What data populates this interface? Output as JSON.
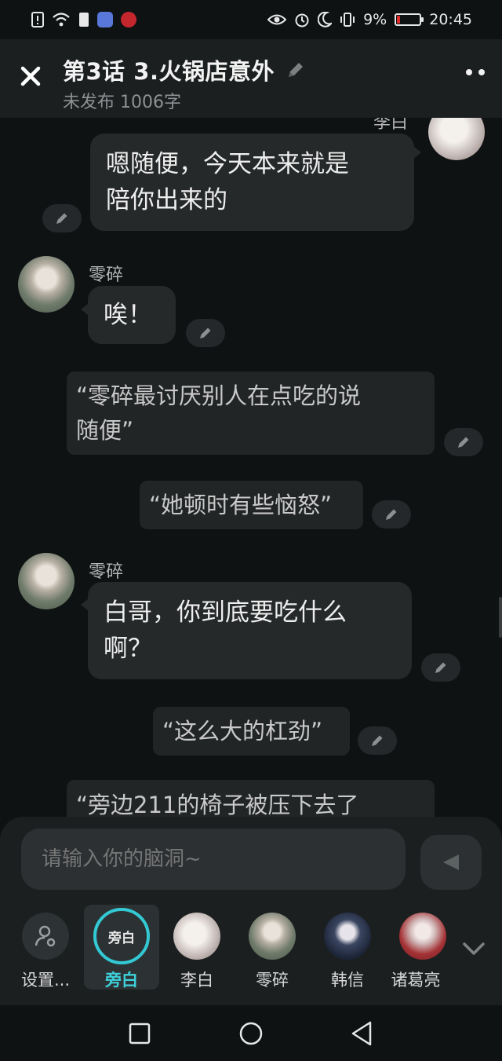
{
  "status_bar": {
    "battery": "9%",
    "time": "20:45",
    "battery_level": 0.09,
    "battery_color": "#e02c2c"
  },
  "header": {
    "title": "第3话  3.火锅店意外",
    "subtitle": "未发布 1006字"
  },
  "messages": {
    "m1": {
      "speaker": "李白",
      "line1": "嗯随便，今天本来就是",
      "line2": "陪你出来的"
    },
    "m2": {
      "speaker": "零碎",
      "line1": "唉！"
    },
    "n1": {
      "line1": "“零碎最讨厌别人在点吃的说",
      "line2": "随便”"
    },
    "n2": {
      "line1": "“她顿时有些恼怒”"
    },
    "m3": {
      "speaker": "零碎",
      "line1": "白哥，你到底要吃什么",
      "line2": "啊？"
    },
    "n3": {
      "line1": "“这么大的杠劲”"
    },
    "n4": {
      "line1": "“旁边211的椅子被压下去了"
    }
  },
  "composer": {
    "placeholder": "请输入你的脑洞~"
  },
  "roles": {
    "settings": "设置...",
    "narrator": "旁白",
    "narrator_ring": "旁白",
    "libai": "李白",
    "lingsui": "零碎",
    "hanxin": "韩信",
    "zhuge": "诸葛亮"
  },
  "colors": {
    "accent": "#33c9d4",
    "bubble": "#26292a",
    "background": "#0e1213"
  }
}
